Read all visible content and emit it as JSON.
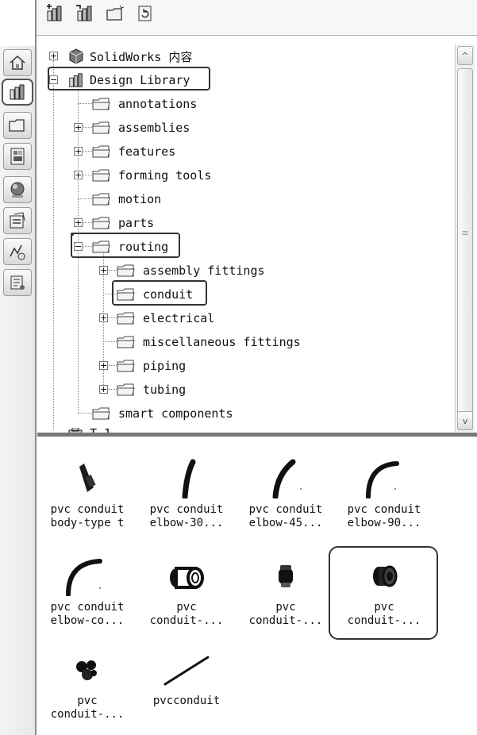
{
  "sidebar": {
    "tabs": [
      {
        "name": "home-icon",
        "active": false
      },
      {
        "name": "design-library-icon",
        "active": true
      },
      {
        "name": "file-explorer-icon",
        "active": false
      },
      {
        "name": "view-palette-icon",
        "active": false
      },
      {
        "name": "appearances-icon",
        "active": false
      },
      {
        "name": "custom-properties-icon",
        "active": false
      },
      {
        "name": "forum-icon",
        "active": false
      },
      {
        "name": "routing-library-icon",
        "active": false
      }
    ]
  },
  "toolbar": {
    "buttons": [
      "add-to-library-icon",
      "add-file-location-icon",
      "create-new-folder-icon",
      "refresh-icon"
    ]
  },
  "tree": {
    "solidworks_content": "SolidWorks 内容",
    "design_library": "Design Library",
    "annotations": "annotations",
    "assemblies": "assemblies",
    "features": "features",
    "forming_tools": "forming tools",
    "motion": "motion",
    "parts": "parts",
    "routing": "routing",
    "assembly_fittings": "assembly fittings",
    "conduit": "conduit",
    "electrical": "electrical",
    "misc_fittings": "miscellaneous fittings",
    "piping": "piping",
    "tubing": "tubing",
    "smart_components": "smart components",
    "toolbox_partial": "T  1"
  },
  "scrollbar": {
    "up": "^",
    "down": "v",
    "grip": "≡"
  },
  "items": [
    {
      "line1": "pvc conduit",
      "line2": "body-type t"
    },
    {
      "line1": "pvc conduit",
      "line2": "elbow-30..."
    },
    {
      "line1": "pvc conduit",
      "line2": "elbow-45..."
    },
    {
      "line1": "pvc conduit",
      "line2": "elbow-90..."
    },
    {
      "line1": "pvc conduit",
      "line2": "elbow-co..."
    },
    {
      "line1": "pvc",
      "line2": "conduit-..."
    },
    {
      "line1": "pvc",
      "line2": "conduit-..."
    },
    {
      "line1": "pvc",
      "line2": "conduit-..."
    },
    {
      "line1": "pvc",
      "line2": "conduit-..."
    },
    {
      "line1": "pvcconduit",
      "line2": ""
    }
  ]
}
